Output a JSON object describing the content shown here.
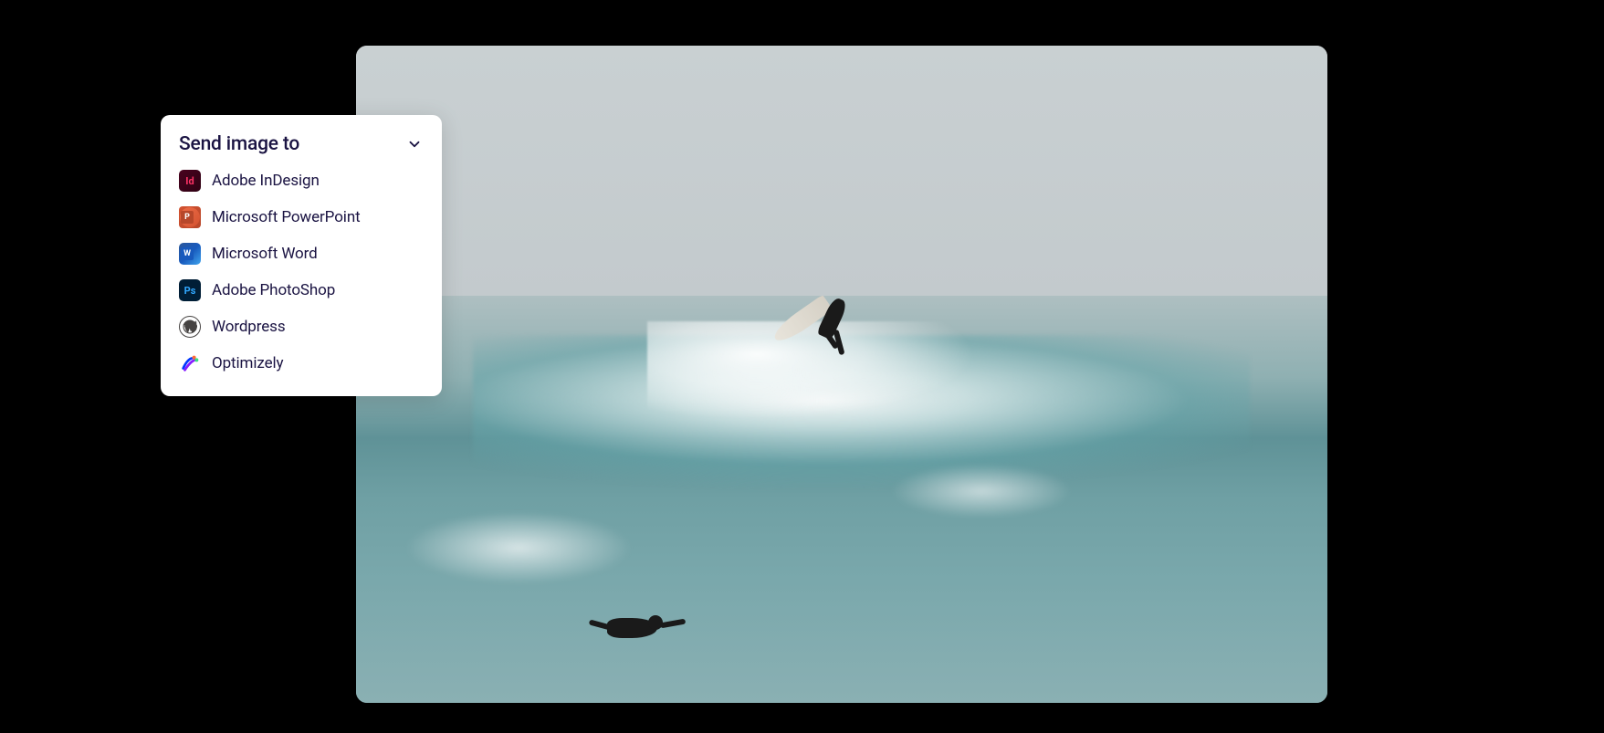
{
  "dropdown": {
    "title": "Send image to",
    "items": [
      {
        "label": "Adobe InDesign",
        "icon": "indesign"
      },
      {
        "label": "Microsoft PowerPoint",
        "icon": "powerpoint"
      },
      {
        "label": "Microsoft Word",
        "icon": "word"
      },
      {
        "label": "Adobe PhotoShop",
        "icon": "photoshop"
      },
      {
        "label": "Wordpress",
        "icon": "wordpress"
      },
      {
        "label": "Optimizely",
        "icon": "optimizely"
      }
    ]
  }
}
